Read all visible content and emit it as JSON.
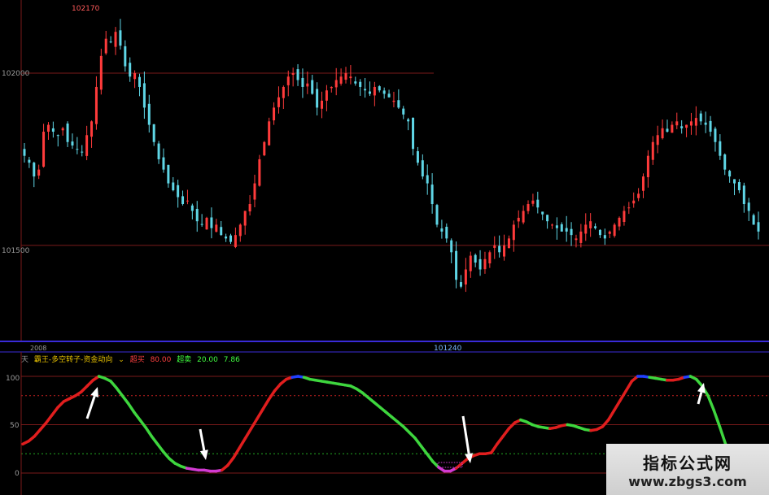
{
  "colors": {
    "background": "#000000",
    "candle_up": "#ff3b3b",
    "candle_down": "#5fd6e6",
    "divider": "#3a2bd8",
    "axis_label": "#9a9a9a",
    "price_label": "#ff5a5a",
    "low_label": "#7ab8ff",
    "osc_up": "#e01e1e",
    "osc_down": "#3ed63e",
    "osc_bottom": "#d23ad2",
    "osc_top": "#2040ff"
  },
  "price_panel": {
    "y_ticks": [
      "102000",
      "101500"
    ],
    "high_label": "102170",
    "low_label": "101240",
    "date_label": "2008"
  },
  "indicator_panel": {
    "tab_label": "天",
    "name": "霸王-多空转子-资金动向",
    "overbought_label": "超买",
    "overbought_value": "80.00",
    "oversold_label": "超卖",
    "oversold_value": "20.00",
    "current_value": "7.86",
    "y_ticks": [
      "100",
      "50",
      "0"
    ],
    "thresholds": [
      80,
      20
    ]
  },
  "watermark": {
    "title": "指标公式网",
    "url": "www.zbgs3.com"
  },
  "chart_data": [
    {
      "type": "candlestick",
      "title": "",
      "ylim": [
        101240,
        102170
      ],
      "y_ticks": [
        102000,
        101500
      ],
      "annotations": [
        "102170",
        "101240"
      ],
      "close_series": [
        101760,
        101740,
        101700,
        101720,
        101830,
        101850,
        101830,
        101820,
        101840,
        101800,
        101790,
        101780,
        101770,
        101820,
        101860,
        101960,
        102050,
        102100,
        102090,
        102120,
        102080,
        102020,
        101990,
        102000,
        101960,
        101900,
        101850,
        101800,
        101750,
        101720,
        101680,
        101660,
        101640,
        101620,
        101630,
        101600,
        101570,
        101560,
        101580,
        101550,
        101560,
        101530,
        101520,
        101510,
        101530,
        101560,
        101600,
        101620,
        101680,
        101750,
        101800,
        101860,
        101900,
        101930,
        101960,
        101990,
        102000,
        101980,
        101960,
        101970,
        101940,
        101900,
        101920,
        101950,
        101960,
        101980,
        101990,
        102000,
        101990,
        101970,
        101960,
        101950,
        101940,
        101960,
        101950,
        101940,
        101930,
        101920,
        101900,
        101880,
        101860,
        101780,
        101740,
        101700,
        101680,
        101620,
        101560,
        101540,
        101520,
        101480,
        101400,
        101380,
        101430,
        101470,
        101450,
        101430,
        101460,
        101480,
        101500,
        101480,
        101500,
        101520,
        101560,
        101580,
        101600,
        101620,
        101630,
        101610,
        101590,
        101570,
        101560,
        101550,
        101540,
        101540,
        101530,
        101520,
        101540,
        101560,
        101570,
        101550,
        101530,
        101520,
        101540,
        101560,
        101580,
        101600,
        101610,
        101630,
        101650,
        101700,
        101760,
        101800,
        101820,
        101840,
        101830,
        101850,
        101860,
        101840,
        101850,
        101860,
        101870,
        101860,
        101850,
        101830,
        101800,
        101760,
        101720,
        101700,
        101680,
        101660,
        101620,
        101600,
        101560,
        101540
      ]
    },
    {
      "type": "line",
      "title": "",
      "ylim": [
        0,
        100
      ],
      "y_ticks": [
        100,
        50,
        0
      ],
      "reference_lines": [
        80,
        20
      ],
      "values": [
        30,
        33,
        38,
        45,
        52,
        60,
        68,
        74,
        77,
        80,
        84,
        90,
        96,
        100,
        98,
        95,
        88,
        80,
        72,
        63,
        55,
        47,
        38,
        30,
        22,
        15,
        10,
        7,
        5,
        4,
        3,
        3,
        2,
        2,
        3,
        8,
        16,
        26,
        36,
        46,
        56,
        66,
        76,
        85,
        92,
        97,
        99,
        100,
        99,
        97,
        96,
        95,
        94,
        93,
        92,
        91,
        90,
        87,
        83,
        78,
        73,
        68,
        63,
        58,
        53,
        48,
        42,
        36,
        28,
        20,
        12,
        6,
        2,
        2,
        5,
        10,
        15,
        18,
        20,
        20,
        21,
        30,
        38,
        46,
        52,
        55,
        53,
        50,
        48,
        47,
        46,
        47,
        49,
        50,
        49,
        47,
        45,
        44,
        45,
        48,
        55,
        65,
        75,
        85,
        95,
        100,
        100,
        99,
        98,
        97,
        96,
        96,
        97,
        99,
        100,
        97,
        90,
        80,
        65,
        48,
        30,
        15,
        5
      ]
    }
  ]
}
